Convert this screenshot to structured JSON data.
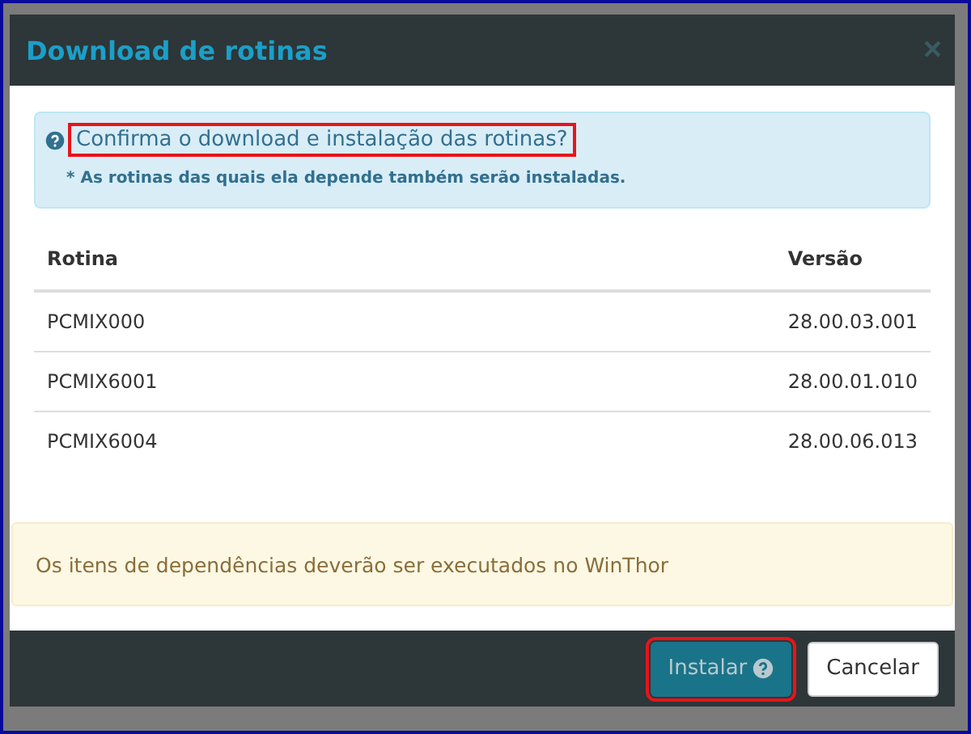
{
  "dialog": {
    "title": "Download de rotinas",
    "close": "×"
  },
  "info": {
    "question": "Confirma o download e instalação das rotinas?",
    "question_highlighted": true,
    "note": "* As rotinas das quais ela depende também serão instaladas."
  },
  "table": {
    "columns": [
      "Rotina",
      "Versão"
    ],
    "rows": [
      [
        "PCMIX000",
        "28.00.03.001"
      ],
      [
        "PCMIX6001",
        "28.00.01.010"
      ],
      [
        "PCMIX6004",
        "28.00.06.013"
      ]
    ]
  },
  "warning": "Os itens de dependências deverão ser executados no WinThor",
  "buttons": [
    {
      "label": "Instalar",
      "kind": "primary",
      "highlighted": true
    },
    {
      "label": "Cancelar",
      "kind": "default",
      "highlighted": false
    }
  ]
}
